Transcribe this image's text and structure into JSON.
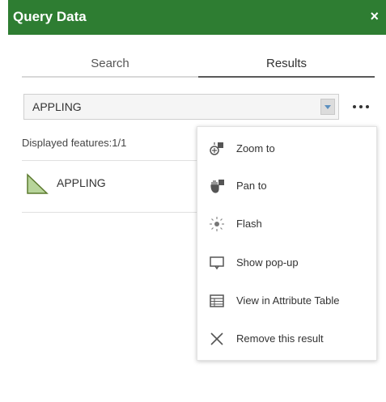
{
  "panel": {
    "title": "Query Data",
    "close_label": "×"
  },
  "tabs": [
    {
      "label": "Search",
      "active": false
    },
    {
      "label": "Results",
      "active": true
    }
  ],
  "result_select": {
    "value": "APPLING"
  },
  "displayed_features": "Displayed features:1/1",
  "features": [
    {
      "name": "APPLING",
      "icon": "polygon-icon"
    }
  ],
  "menu": {
    "items": [
      {
        "label": "Zoom to",
        "icon": "zoom-to-icon"
      },
      {
        "label": "Pan to",
        "icon": "pan-to-icon"
      },
      {
        "label": "Flash",
        "icon": "flash-icon"
      },
      {
        "label": "Show pop-up",
        "icon": "popup-icon"
      },
      {
        "label": "View in Attribute Table",
        "icon": "table-icon"
      },
      {
        "label": "Remove this result",
        "icon": "remove-icon"
      }
    ]
  },
  "colors": {
    "header_bg": "#2e7d32",
    "polygon_fill": "#b7d49a",
    "polygon_stroke": "#5c7a2e"
  }
}
